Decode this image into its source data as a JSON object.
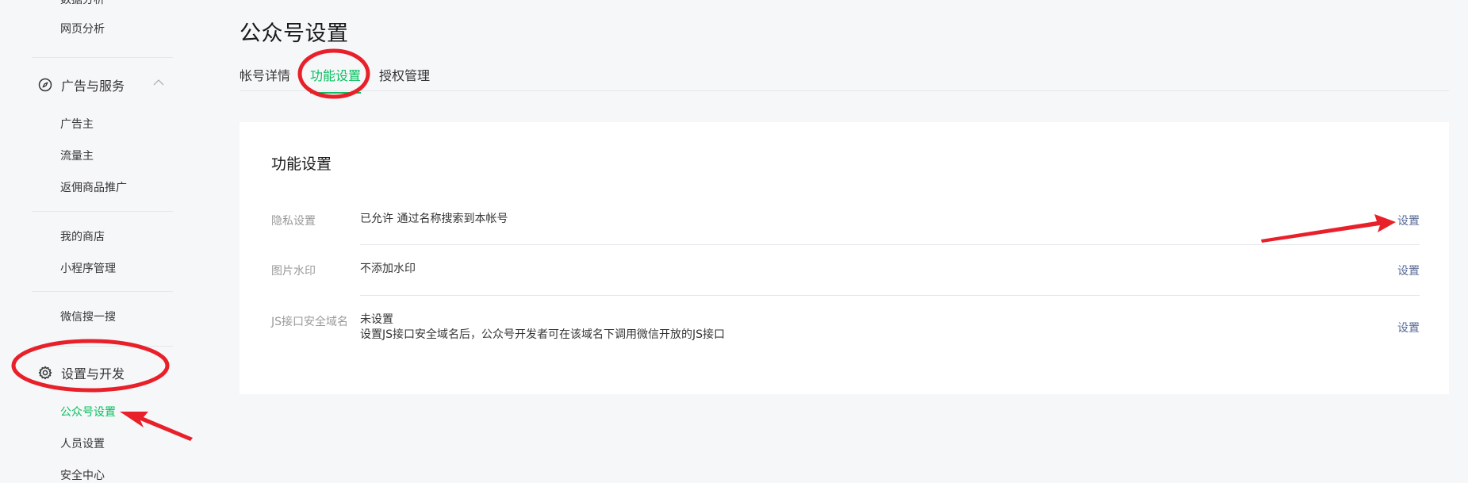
{
  "sidebar": {
    "partial_top": "数据分析",
    "web_analytics": "网页分析",
    "group_ads": {
      "label": "广告与服务",
      "icon": "compass-icon"
    },
    "ads_items": [
      "广告主",
      "流量主",
      "返佣商品推广"
    ],
    "shop": "我的商店",
    "miniprogram": "小程序管理",
    "wechat_search": "微信搜一搜",
    "group_settings": {
      "label": "设置与开发",
      "icon": "gear-icon"
    },
    "settings_items": [
      "公众号设置",
      "人员设置",
      "安全中心"
    ]
  },
  "page": {
    "title": "公众号设置",
    "tabs": [
      "帐号详情",
      "功能设置",
      "授权管理"
    ],
    "active_tab": "功能设置"
  },
  "card": {
    "title": "功能设置",
    "rows": [
      {
        "label": "隐私设置",
        "value": "已允许 通过名称搜索到本帐号",
        "action": "设置"
      },
      {
        "label": "图片水印",
        "value": "不添加水印",
        "action": "设置"
      },
      {
        "label": "JS接口安全域名",
        "value": "未设置",
        "value2": "设置JS接口安全域名后，公众号开发者可在该域名下调用微信开放的JS接口",
        "action": "设置"
      }
    ]
  },
  "colors": {
    "accent": "#07c160",
    "link": "#576b95",
    "annotation": "#e8202a"
  }
}
